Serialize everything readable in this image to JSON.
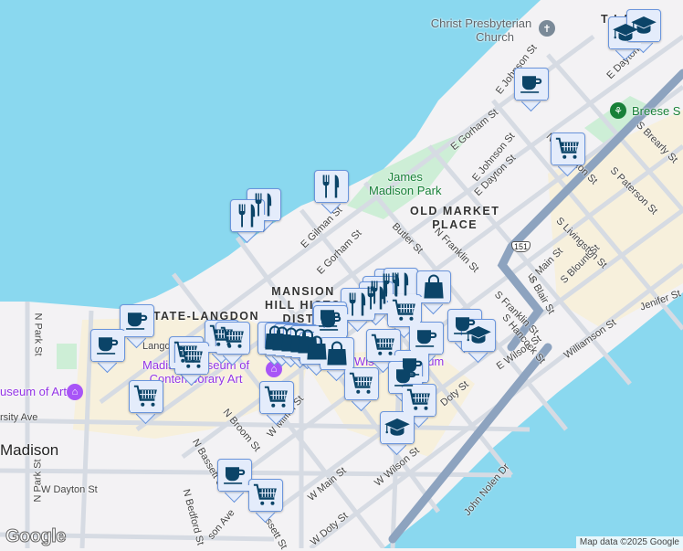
{
  "map": {
    "districts": [
      "MANSION HILL HISTORIC DISTRICT",
      "OLD MARKET PLACE",
      "STATE-LANGDON"
    ],
    "district_lines": {
      "mansion": [
        "MANSION",
        "HILL HISTO",
        "DISTR"
      ],
      "old_market": [
        "OLD MARKET",
        "PLACE"
      ],
      "state_langdon": "STATE-LANGDON",
      "tenney": "T         LAP"
    },
    "city": "Madison",
    "pois": {
      "church": [
        "Christ Presbyterian",
        "Church"
      ],
      "park": [
        "James",
        "Madison Park"
      ],
      "breese": "Breese S",
      "mmoca": [
        "Madison Museum of",
        "Contemporary Art"
      ],
      "chazen": "useum of Art",
      "wisconsin_vet": "Wis    Veter    useum"
    },
    "streets": [
      "E Johnson St",
      "E Gorham St",
      "E Johnson St",
      "E Dayton St",
      "E Dayton St",
      "N Livingston St",
      "S Livingston St",
      "S Paterson St",
      "S Brearly St",
      "E Gorham St",
      "E Gilman St",
      "N Franklin St",
      "S Franklin St",
      "E Main St",
      "S Blount St",
      "Jenifer St",
      "Williamson St",
      "S Blair St",
      "E Wilson St",
      "John Nolen Dr",
      "Doty St",
      "W Wilson St",
      "W Main St",
      "W Doty St",
      "W Mifflin St",
      "N Broom St",
      "N Bassett St",
      "S Bassett St",
      "N Bedford St",
      "W Dayton St",
      "N Park St",
      "N Park St",
      "rsity Ave",
      "Langdon St",
      "son Ave",
      "S Hancock St",
      "Butler St"
    ],
    "highway_shield": "151",
    "attribution": "Map data ©2025 Google",
    "logo": "Google",
    "markers": [
      {
        "icon": "grad"
      },
      {
        "icon": "grad"
      },
      {
        "icon": "coffee"
      },
      {
        "icon": "cart"
      },
      {
        "icon": "restaurant"
      },
      {
        "icon": "restaurant"
      },
      {
        "icon": "restaurant"
      },
      {
        "icon": "coffee"
      },
      {
        "icon": "coffee"
      },
      {
        "icon": "cart"
      },
      {
        "icon": "cart"
      },
      {
        "icon": "cart"
      },
      {
        "icon": "cart"
      },
      {
        "icon": "cart"
      },
      {
        "icon": "restaurant"
      },
      {
        "icon": "restaurant"
      },
      {
        "icon": "restaurant"
      },
      {
        "icon": "restaurant"
      },
      {
        "icon": "bag"
      },
      {
        "icon": "restaurant"
      },
      {
        "icon": "cart"
      },
      {
        "icon": "coffee"
      },
      {
        "icon": "coffee"
      },
      {
        "icon": "bag"
      },
      {
        "icon": "bag"
      },
      {
        "icon": "bag"
      },
      {
        "icon": "bag"
      },
      {
        "icon": "bag"
      },
      {
        "icon": "bag"
      },
      {
        "icon": "bag"
      },
      {
        "icon": "cart"
      },
      {
        "icon": "coffee"
      },
      {
        "icon": "coffee"
      },
      {
        "icon": "grad"
      },
      {
        "icon": "coffee"
      },
      {
        "icon": "coffee"
      },
      {
        "icon": "cart"
      },
      {
        "icon": "cart"
      },
      {
        "icon": "grad"
      },
      {
        "icon": "cart"
      },
      {
        "icon": "coffee"
      },
      {
        "icon": "cart"
      }
    ],
    "colors": {
      "water": "#8ad8ef",
      "land": "#f3f2f4",
      "park": "#cdeed6",
      "road": "#d6dbe3",
      "highway": "#8da3bf",
      "commercial": "#f7f0dc",
      "marker_fill": "#e4ecfb",
      "marker_border": "#6a95dc",
      "icon": "#0c4a6e"
    }
  }
}
